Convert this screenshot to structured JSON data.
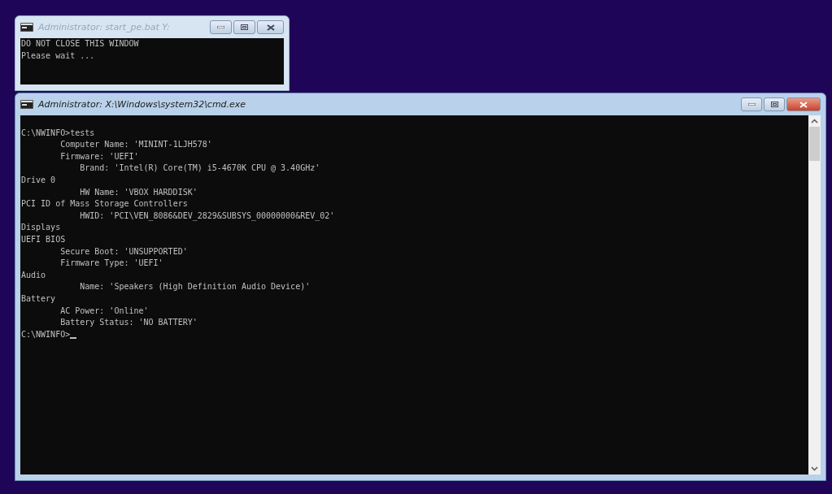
{
  "windows": [
    {
      "title": "Administrator:  start_pe.bat Y:",
      "active": false,
      "kind": "small",
      "lines": [
        {
          "kind": "plain",
          "text": "DO NOT CLOSE THIS WINDOW"
        },
        {
          "kind": "plain",
          "text": "Please wait ..."
        }
      ]
    },
    {
      "title": "Administrator: X:\\Windows\\system32\\cmd.exe",
      "active": true,
      "kind": "main",
      "scrollbar": true,
      "lines": [
        {
          "kind": "blank"
        },
        {
          "kind": "plain",
          "text": "C:\\NWINFO>tests"
        },
        {
          "kind": "field",
          "text": "Computer Name: 'MININT-1LJH578'"
        },
        {
          "kind": "field",
          "text": "Firmware: 'UEFI'"
        },
        {
          "kind": "subfield",
          "text": "Brand: 'Intel(R) Core(TM) i5-4670K CPU @ 3.40GHz'"
        },
        {
          "kind": "plain",
          "text": "Drive 0"
        },
        {
          "kind": "subfield",
          "text": "HW Name: 'VBOX HARDDISK'"
        },
        {
          "kind": "plain",
          "text": "PCI ID of Mass Storage Controllers"
        },
        {
          "kind": "subfield",
          "text": "HWID: 'PCI\\VEN_8086&DEV_2829&SUBSYS_00000000&REV_02'"
        },
        {
          "kind": "plain",
          "text": "Displays"
        },
        {
          "kind": "plain",
          "text": "UEFI BIOS"
        },
        {
          "kind": "field",
          "text": "Secure Boot: 'UNSUPPORTED'"
        },
        {
          "kind": "field",
          "text": "Firmware Type: 'UEFI'"
        },
        {
          "kind": "plain",
          "text": "Audio"
        },
        {
          "kind": "subfield",
          "text": "Name: 'Speakers (High Definition Audio Device)'"
        },
        {
          "kind": "plain",
          "text": "Battery"
        },
        {
          "kind": "field",
          "text": "AC Power: 'Online'"
        },
        {
          "kind": "field",
          "text": "Battery Status: 'NO BATTERY'"
        },
        {
          "kind": "plain",
          "text": "C:\\NWINFO>"
        }
      ],
      "cursor": true
    }
  ]
}
